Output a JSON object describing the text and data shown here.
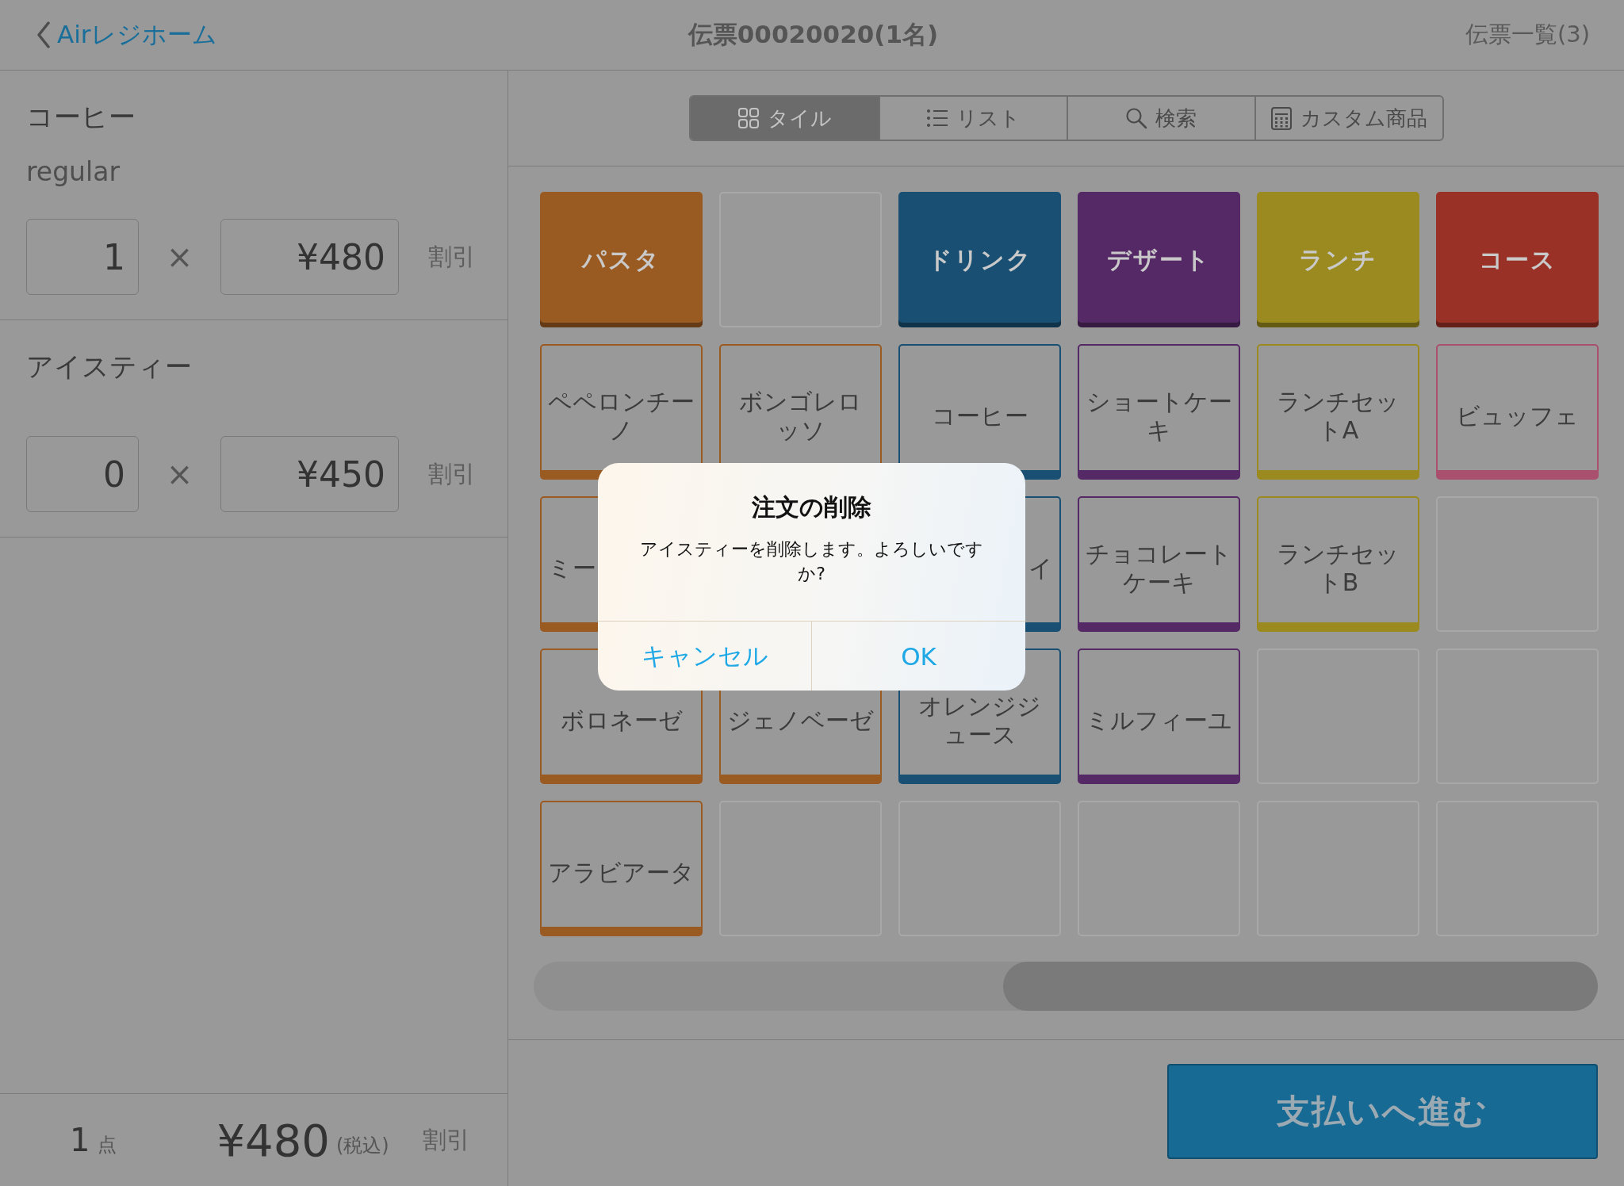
{
  "header": {
    "back": {
      "label": "Airレジホーム"
    },
    "title": "伝票00020020(1名)",
    "right_link": "伝票一覧(3)"
  },
  "order": {
    "lines": [
      {
        "name": "コーヒー",
        "option": "regular",
        "quantity": "1",
        "times": "×",
        "price": "¥480",
        "discount": "割引"
      },
      {
        "name": "アイスティー",
        "quantity": "0",
        "times": "×",
        "price": "¥450",
        "discount": "割引"
      }
    ],
    "footer": {
      "count": "1",
      "count_unit": "点",
      "total": "¥480",
      "tax_note": "(税込)",
      "discount": "割引"
    }
  },
  "view_tabs": [
    {
      "label": "タイル",
      "selected": true
    },
    {
      "label": "リスト",
      "selected": false
    },
    {
      "label": "検索",
      "selected": false
    },
    {
      "label": "カスタム商品",
      "selected": false
    }
  ],
  "tiles": [
    {
      "kind": "category",
      "label": "パスタ",
      "color": "#9a5b22"
    },
    {
      "kind": "empty"
    },
    {
      "kind": "category",
      "label": "ドリンク",
      "color": "#184f72"
    },
    {
      "kind": "category",
      "label": "デザート",
      "color": "#552866"
    },
    {
      "kind": "category",
      "label": "ランチ",
      "color": "#9a8a1f"
    },
    {
      "kind": "category",
      "label": "コース",
      "color": "#9a3127"
    },
    {
      "kind": "item",
      "label": "ペペロンチーノ",
      "color": "#9a5b22"
    },
    {
      "kind": "item",
      "label": "ボンゴレロッソ",
      "color": "#9a5b22"
    },
    {
      "kind": "item",
      "label": "コーヒー",
      "color": "#184f72"
    },
    {
      "kind": "item",
      "label": "ショートケーキ",
      "color": "#552866"
    },
    {
      "kind": "item",
      "label": "ランチセットA",
      "color": "#9a8a1f"
    },
    {
      "kind": "item",
      "label": "ビュッフェ",
      "color": "#a9506f"
    },
    {
      "kind": "covered",
      "label": "ミー",
      "color": "#9a5b22"
    },
    {
      "kind": "hidden"
    },
    {
      "kind": "covered",
      "label": "イ",
      "color": "#184f72"
    },
    {
      "kind": "item",
      "label": "チョコレートケーキ",
      "color": "#552866"
    },
    {
      "kind": "item",
      "label": "ランチセットB",
      "color": "#9a8a1f"
    },
    {
      "kind": "empty"
    },
    {
      "kind": "item",
      "label": "ボロネーゼ",
      "color": "#9a5b22"
    },
    {
      "kind": "item",
      "label": "ジェノベーゼ",
      "color": "#9a5b22"
    },
    {
      "kind": "item",
      "label": "オレンジジュース",
      "color": "#184f72"
    },
    {
      "kind": "item",
      "label": "ミルフィーユ",
      "color": "#552866"
    },
    {
      "kind": "empty"
    },
    {
      "kind": "empty"
    },
    {
      "kind": "item",
      "label": "アラビアータ",
      "color": "#9a5b22"
    },
    {
      "kind": "empty"
    },
    {
      "kind": "empty"
    },
    {
      "kind": "empty"
    },
    {
      "kind": "empty"
    },
    {
      "kind": "empty"
    }
  ],
  "pay_button": "支払いへ進む",
  "dialog": {
    "title": "注文の削除",
    "message": "アイスティーを削除します。よろしいですか?",
    "buttons": [
      "キャンセル",
      "OK"
    ]
  }
}
